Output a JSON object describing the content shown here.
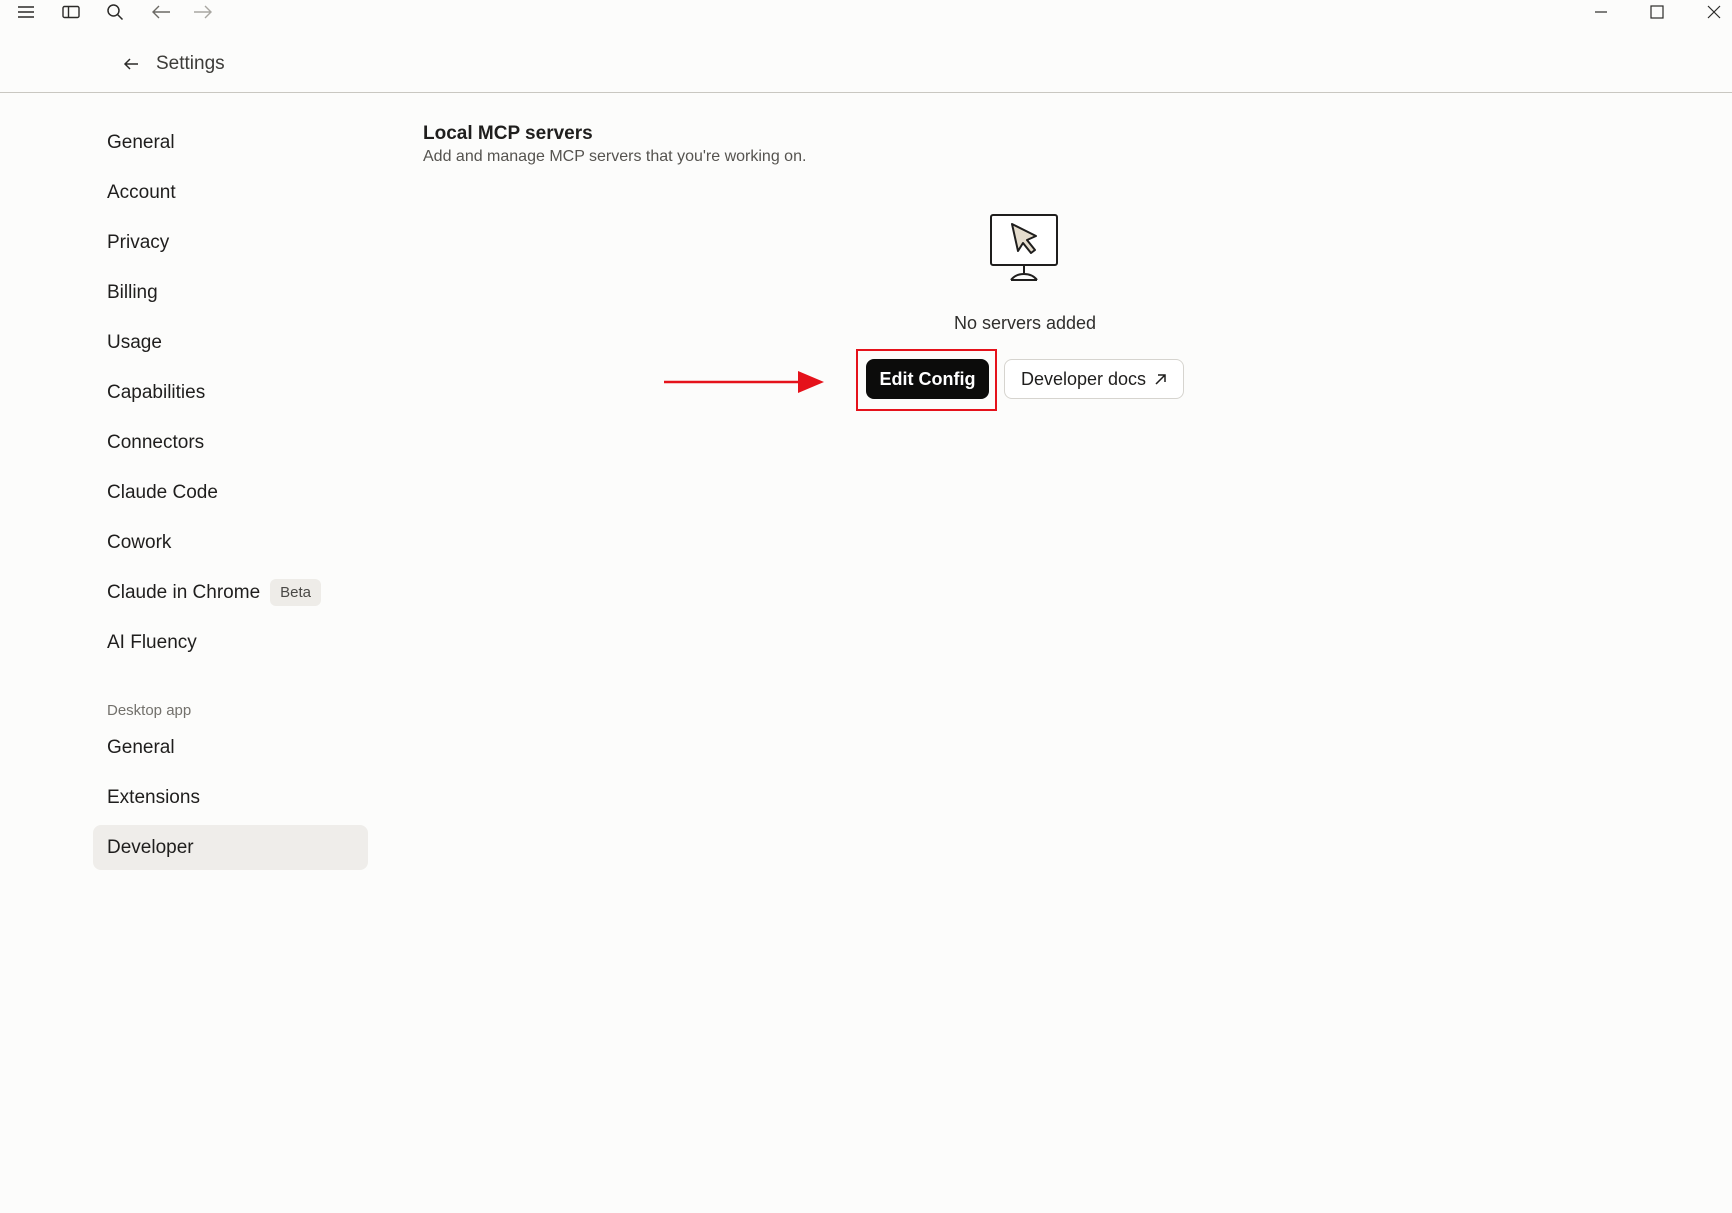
{
  "header": {
    "title": "Settings"
  },
  "sidebar": {
    "items": [
      {
        "label": "General"
      },
      {
        "label": "Account"
      },
      {
        "label": "Privacy"
      },
      {
        "label": "Billing"
      },
      {
        "label": "Usage"
      },
      {
        "label": "Capabilities"
      },
      {
        "label": "Connectors"
      },
      {
        "label": "Claude Code"
      },
      {
        "label": "Cowork"
      },
      {
        "label": "Claude in Chrome",
        "badge": "Beta"
      },
      {
        "label": "AI Fluency"
      }
    ],
    "section_label": "Desktop app",
    "desktop_items": [
      {
        "label": "General"
      },
      {
        "label": "Extensions"
      },
      {
        "label": "Developer",
        "active": true
      }
    ]
  },
  "main": {
    "title": "Local MCP servers",
    "subtitle": "Add and manage MCP servers that you're working on.",
    "empty_state": "No servers added",
    "edit_config_label": "Edit Config",
    "developer_docs_label": "Developer docs"
  },
  "colors": {
    "background": "#fcfcfb",
    "primary_button": "#0c0c0b",
    "annotation_red": "#e5121b",
    "active_item": "#efedea"
  },
  "icons": {
    "titlebar": [
      "menu-icon",
      "sidebar-toggle-icon",
      "search-icon",
      "arrow-left-icon",
      "arrow-right-icon",
      "minimize-icon",
      "maximize-icon",
      "close-icon"
    ],
    "empty_state": "monitor-cursor-icon",
    "external_link": "arrow-up-right-icon"
  }
}
